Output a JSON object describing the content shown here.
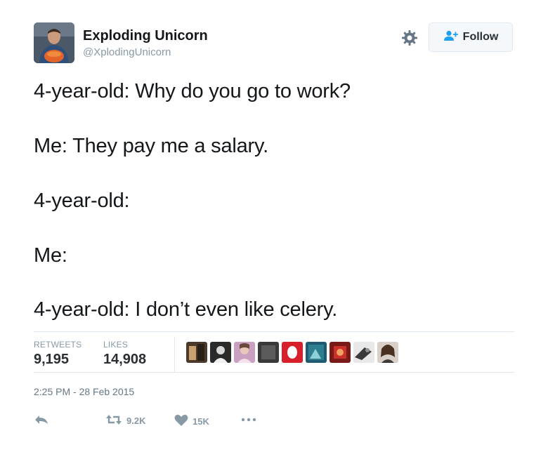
{
  "user": {
    "name": "Exploding Unicorn",
    "handle": "@XplodingUnicorn"
  },
  "follow_button": {
    "label": "Follow",
    "icon": "add-user-icon"
  },
  "settings_icon": "gear-icon",
  "tweet": {
    "lines": [
      "4-year-old: Why do you go to work?",
      "Me: They pay me a salary.",
      "4-year-old:",
      "Me:",
      "4-year-old: I don’t even like celery."
    ]
  },
  "stats": {
    "retweets_label": "RETWEETS",
    "retweets_value": "9,195",
    "likes_label": "LIKES",
    "likes_value": "14,908"
  },
  "liker_avatar_count": 10,
  "timestamp": "2:25 PM - 28 Feb 2015",
  "actions": {
    "reply_icon": "reply-icon",
    "retweet_icon": "retweet-icon",
    "retweet_count": "9.2K",
    "like_icon": "heart-icon",
    "like_count": "15K",
    "more_icon": "more-icon"
  },
  "colors": {
    "text": "#14171a",
    "secondary": "#8899a6",
    "follow_icon": "#1da1f2",
    "divider": "#e1e8ed"
  }
}
